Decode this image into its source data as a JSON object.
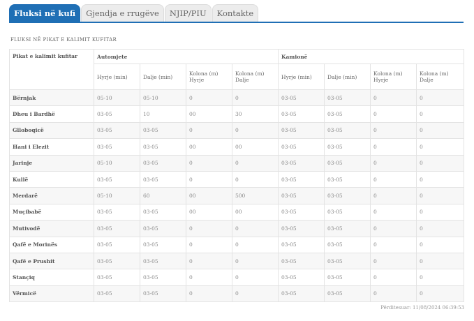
{
  "tabs": [
    {
      "label": "Fluksi në kufi",
      "active": true
    },
    {
      "label": "Gjendja e rrugëve",
      "active": false
    },
    {
      "label": "NJIP/PIU",
      "active": false
    },
    {
      "label": "Kontakte",
      "active": false
    }
  ],
  "section_title": "FLUKSI NË PIKAT E KALIMIT KUFITAR",
  "table": {
    "header_name": "Pikat e kalimit kufitar",
    "group_cars": "Automjete",
    "group_trucks": "Kamionë",
    "sub_headers": [
      "Hyrje (min)",
      "Dalje (min)",
      "Kolona (m) Hyrje",
      "Kolona (m) Dalje",
      "Hyrje (min)",
      "Dalje (min)",
      "Kolona (m) Hyrje",
      "Kolona (m) Dalje"
    ],
    "rows": [
      {
        "name": "Bërnjak",
        "cells": [
          "05-10",
          "05-10",
          "0",
          "0",
          "03-05",
          "03-05",
          "0",
          "0"
        ]
      },
      {
        "name": "Dheu i Bardhë",
        "cells": [
          "03-05",
          "10",
          "00",
          "30",
          "03-05",
          "03-05",
          "0",
          "0"
        ]
      },
      {
        "name": "Glloboqicë",
        "cells": [
          "03-05",
          "03-05",
          "0",
          "0",
          "03-05",
          "03-05",
          "0",
          "0"
        ]
      },
      {
        "name": "Hani i Elezit",
        "cells": [
          "03-05",
          "03-05",
          "00",
          "00",
          "03-05",
          "03-05",
          "0",
          "0"
        ]
      },
      {
        "name": "Jarinje",
        "cells": [
          "05-10",
          "03-05",
          "0",
          "0",
          "03-05",
          "03-05",
          "0",
          "0"
        ]
      },
      {
        "name": "Kullë",
        "cells": [
          "03-05",
          "03-05",
          "0",
          "0",
          "03-05",
          "03-05",
          "0",
          "0"
        ]
      },
      {
        "name": "Merdarë",
        "cells": [
          "05-10",
          "60",
          "00",
          "500",
          "03-05",
          "03-05",
          "0",
          "0"
        ]
      },
      {
        "name": "Muçibabë",
        "cells": [
          "03-05",
          "03-05",
          "00",
          "00",
          "03-05",
          "03-05",
          "0",
          "0"
        ]
      },
      {
        "name": "Mutivodë",
        "cells": [
          "03-05",
          "03-05",
          "0",
          "0",
          "03-05",
          "03-05",
          "0",
          "0"
        ]
      },
      {
        "name": "Qafë e Morinës",
        "cells": [
          "03-05",
          "03-05",
          "0",
          "0",
          "03-05",
          "03-05",
          "0",
          "0"
        ]
      },
      {
        "name": "Qafë e Prushit",
        "cells": [
          "03-05",
          "03-05",
          "0",
          "0",
          "03-05",
          "03-05",
          "0",
          "0"
        ]
      },
      {
        "name": "Stançiq",
        "cells": [
          "03-05",
          "03-05",
          "0",
          "0",
          "03-05",
          "03-05",
          "0",
          "0"
        ]
      },
      {
        "name": "Vërmicë",
        "cells": [
          "03-05",
          "03-05",
          "0",
          "0",
          "03-05",
          "03-05",
          "0",
          "0"
        ]
      }
    ]
  },
  "updated": "Përditesuar: 11/08/2024 06:39:53",
  "colors": {
    "accent": "#1f6fb5"
  }
}
